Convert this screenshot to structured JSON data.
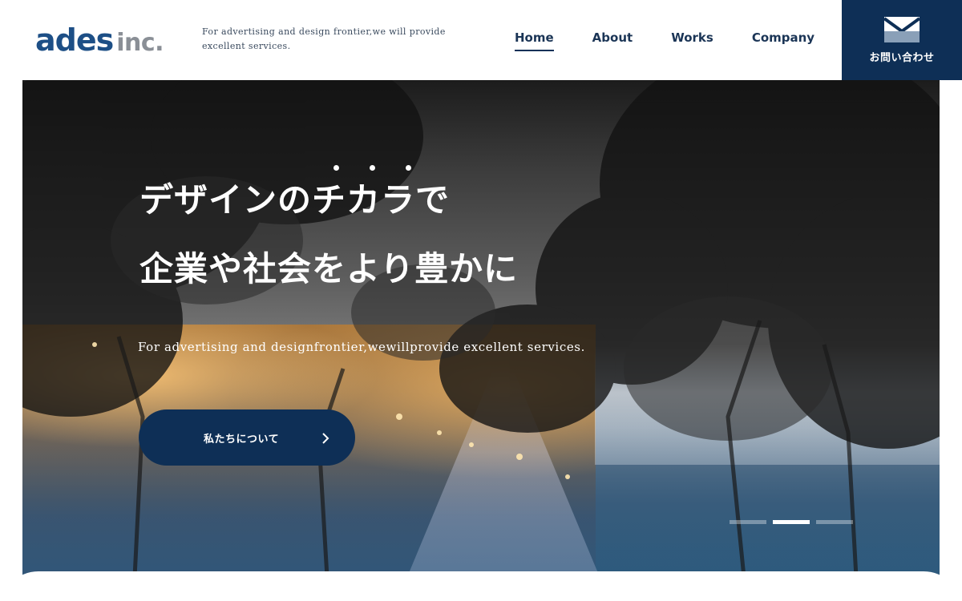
{
  "header": {
    "logo": {
      "primary": "ades",
      "secondary": "inc."
    },
    "tagline": "For advertising and design frontier,we will provide excellent services.",
    "nav": [
      {
        "label": "Home",
        "active": true
      },
      {
        "label": "About",
        "active": false
      },
      {
        "label": "Works",
        "active": false
      },
      {
        "label": "Company",
        "active": false
      }
    ],
    "contact": {
      "label": "お問い合わせ",
      "icon": "mail-icon"
    }
  },
  "hero": {
    "line1": "デザインのチカラで",
    "line2": "企業や社会をより豊かに",
    "subtitle": "For advertising and designfrontier,wewillprovide excellent services.",
    "cta": {
      "label": "私たちについて",
      "icon": "chevron-right-icon"
    },
    "slides": {
      "count": 3,
      "active": 2
    }
  },
  "colors": {
    "brand_navy": "#0e2f56",
    "logo_blue": "#1d4f86",
    "logo_gray": "#8a8f96"
  }
}
